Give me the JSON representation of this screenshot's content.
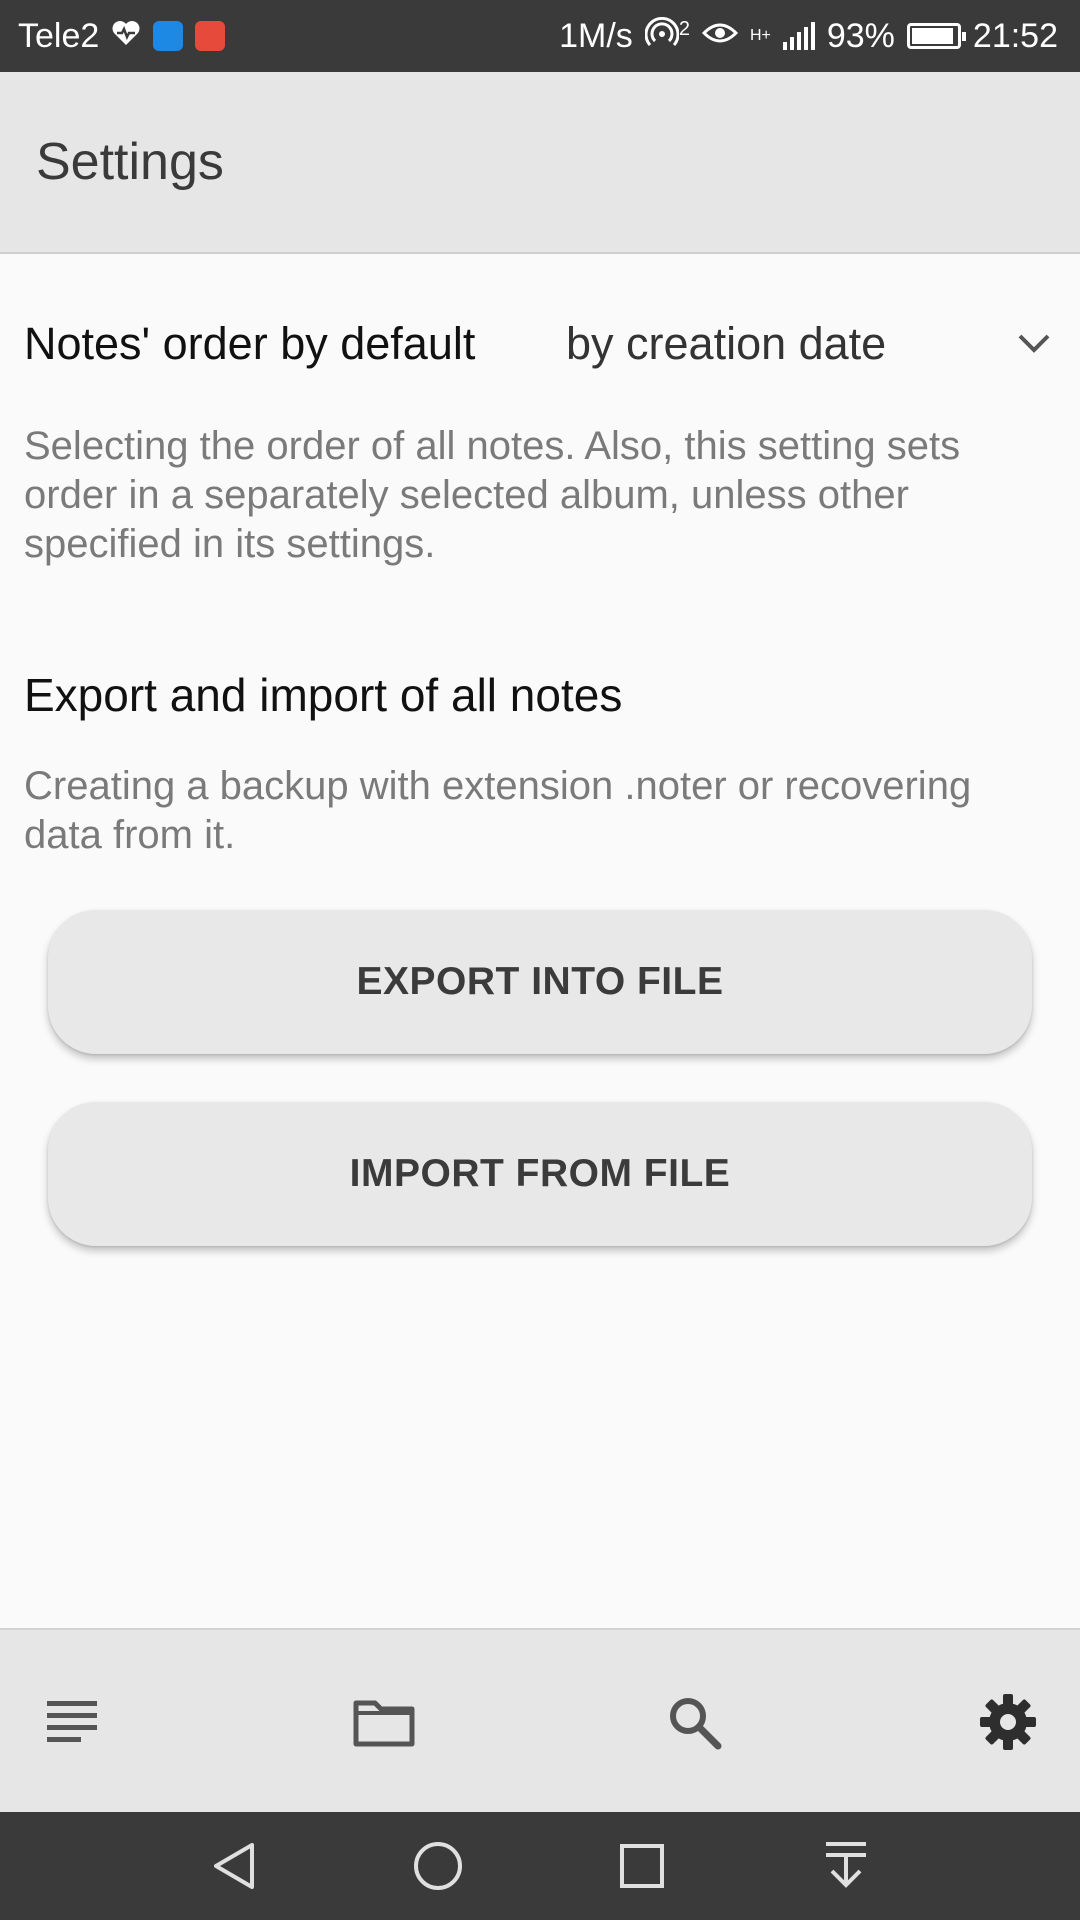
{
  "status_bar": {
    "carrier": "Tele2",
    "speed": "1M/s",
    "hotspot_count": "2",
    "network_type": "H+",
    "battery": "93%",
    "battery_level": 0.93,
    "time": "21:52"
  },
  "app_bar": {
    "title": "Settings"
  },
  "settings": {
    "order_label": "Notes' order by default",
    "order_value": "by creation date",
    "order_description": "Selecting the order of all notes. Also, this setting sets order in a separately selected album, unless other specified in its settings.",
    "export_title": "Export and import of all notes",
    "export_description": "Creating a backup with extension .noter or recovering data from it.",
    "export_button": "EXPORT INTO FILE",
    "import_button": "IMPORT FROM FILE"
  },
  "bottom_nav": {
    "items": [
      {
        "icon": "notes-list-icon"
      },
      {
        "icon": "folder-icon"
      },
      {
        "icon": "search-icon"
      },
      {
        "icon": "gear-icon",
        "active": true
      }
    ]
  },
  "system_nav": [
    "back-icon",
    "home-icon",
    "recent-apps-icon",
    "notification-drawer-icon"
  ],
  "colors": {
    "status_bar": "#3a3a3a",
    "app_bar": "#e6e6e6",
    "background": "#fafafa",
    "button": "#e8e8e8"
  }
}
